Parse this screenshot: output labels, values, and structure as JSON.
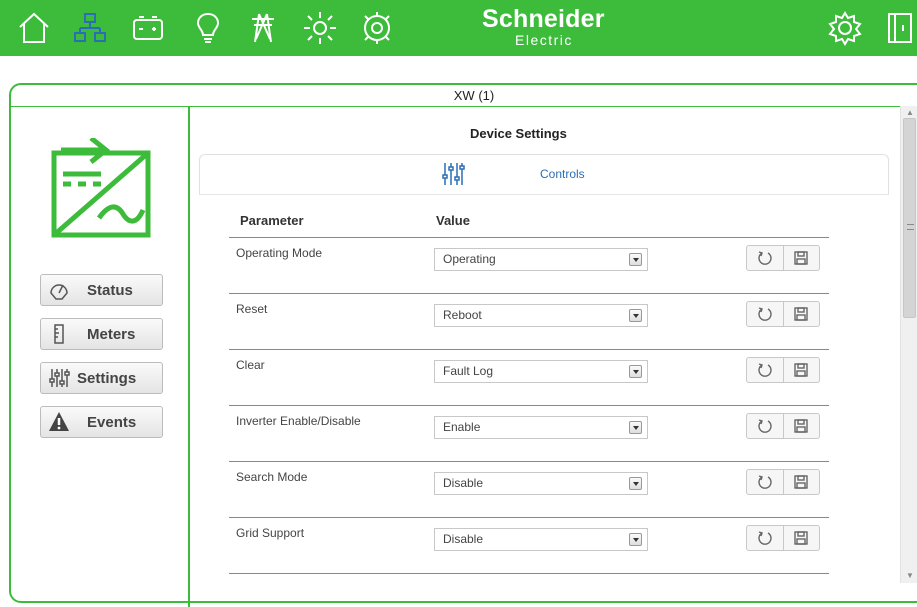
{
  "brand": {
    "line1": "Schneider",
    "line2": "Electric"
  },
  "topnav_icons": [
    "home-icon",
    "network-icon",
    "battery-icon",
    "lightbulb-icon",
    "tower-icon",
    "sun-icon",
    "generator-icon"
  ],
  "device": {
    "title": "XW (1)"
  },
  "sidebar": {
    "items": [
      {
        "label": "Status",
        "icon": "gauge-icon"
      },
      {
        "label": "Meters",
        "icon": "meter-icon"
      },
      {
        "label": "Settings",
        "icon": "sliders-icon"
      },
      {
        "label": "Events",
        "icon": "warning-icon"
      }
    ]
  },
  "main": {
    "title": "Device Settings",
    "tab": "Controls",
    "columns": {
      "parameter": "Parameter",
      "value": "Value"
    },
    "rows": [
      {
        "parameter": "Operating Mode",
        "value": "Operating"
      },
      {
        "parameter": "Reset",
        "value": "Reboot"
      },
      {
        "parameter": "Clear",
        "value": "Fault Log"
      },
      {
        "parameter": "Inverter Enable/Disable",
        "value": "Enable"
      },
      {
        "parameter": "Search Mode",
        "value": "Disable"
      },
      {
        "parameter": "Grid Support",
        "value": "Disable"
      }
    ]
  },
  "colors": {
    "accent": "#3dbb3a",
    "tab_link": "#2a6fb5"
  }
}
